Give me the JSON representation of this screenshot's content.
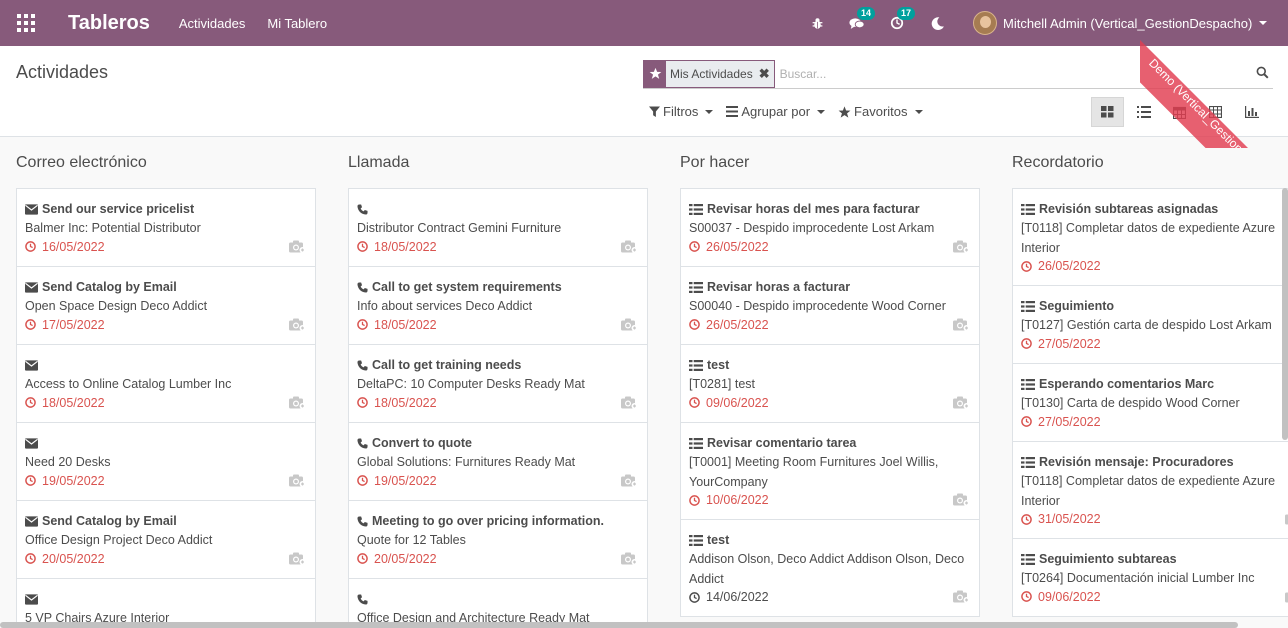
{
  "navbar": {
    "brand": "Tableros",
    "menu": [
      "Actividades",
      "Mi Tablero"
    ],
    "messages_count": "14",
    "activities_count": "17",
    "user": "Mitchell Admin (Vertical_GestionDespacho)"
  },
  "ribbon": {
    "text": "Demo (Vertical_GestionDespacho)"
  },
  "control_panel": {
    "breadcrumb": "Actividades",
    "facet": "Mis Actividades",
    "search_placeholder": "Buscar...",
    "filters_label": "Filtros",
    "groupby_label": "Agrupar por",
    "favorites_label": "Favoritos"
  },
  "colors": {
    "navbar": "#875a7b",
    "overdue": "#d9534f",
    "badge": "#00a09d"
  },
  "columns": [
    {
      "title": "Correo electrónico",
      "icon": "envelope-icon",
      "cards": [
        {
          "title": "Send our service pricelist",
          "body": "Balmer Inc: Potential Distributor",
          "date": "16/05/2022"
        },
        {
          "title": "Send Catalog by Email",
          "body": "Open Space Design Deco Addict",
          "date": "17/05/2022"
        },
        {
          "title": "",
          "body": "Access to Online Catalog Lumber Inc",
          "date": "18/05/2022"
        },
        {
          "title": "",
          "body": "Need 20 Desks",
          "date": "19/05/2022"
        },
        {
          "title": "Send Catalog by Email",
          "body": "Office Design Project Deco Addict",
          "date": "20/05/2022"
        },
        {
          "title": "",
          "body": "5 VP Chairs Azure Interior",
          "date": ""
        }
      ]
    },
    {
      "title": "Llamada",
      "icon": "phone-icon",
      "cards": [
        {
          "title": "",
          "body": "Distributor Contract Gemini Furniture",
          "date": "18/05/2022"
        },
        {
          "title": "Call to get system requirements",
          "body": "Info about services Deco Addict",
          "date": "18/05/2022"
        },
        {
          "title": "Call to get training needs",
          "body": "DeltaPC: 10 Computer Desks Ready Mat",
          "date": "18/05/2022"
        },
        {
          "title": "Convert to quote",
          "body": "Global Solutions: Furnitures Ready Mat",
          "date": "19/05/2022"
        },
        {
          "title": "Meeting to go over pricing information.",
          "body": "Quote for 12 Tables",
          "date": "20/05/2022"
        },
        {
          "title": "",
          "body": "Office Design and Architecture Ready Mat",
          "date": ""
        }
      ]
    },
    {
      "title": "Por hacer",
      "icon": "tasks-icon",
      "cards": [
        {
          "title": "Revisar horas del mes para facturar",
          "body": "S00037 - Despido improcedente Lost Arkam",
          "date": "26/05/2022"
        },
        {
          "title": "Revisar horas a facturar",
          "body": "S00040 - Despido improcedente Wood Corner",
          "date": "26/05/2022"
        },
        {
          "title": "test",
          "body": "[T0281] test",
          "date": "09/06/2022"
        },
        {
          "title": "Revisar comentario tarea",
          "body": "[T0001] Meeting Room Furnitures Joel Willis, YourCompany",
          "date": "10/06/2022",
          "tall": true
        },
        {
          "title": "test",
          "body": "Addison Olson, Deco Addict Addison Olson, Deco Addict",
          "date": "14/06/2022",
          "tall": true,
          "ok": true
        }
      ]
    },
    {
      "title": "Recordatorio",
      "icon": "tasks-icon",
      "cards": [
        {
          "title": "Revisión subtareas asignadas",
          "body": "[T0118] Completar datos de expediente Azure Interior",
          "date": "26/05/2022",
          "tall": true
        },
        {
          "title": "Seguimiento",
          "body": "[T0127] Gestión carta de despido Lost Arkam",
          "date": "27/05/2022"
        },
        {
          "title": "Esperando comentarios Marc",
          "body": "[T0130] Carta de despido Wood Corner",
          "date": "27/05/2022"
        },
        {
          "title": "Revisión mensaje: Procuradores",
          "body": "[T0118] Completar datos de expediente Azure Interior",
          "date": "31/05/2022",
          "tall": true
        },
        {
          "title": "Seguimiento subtareas",
          "body": "[T0264] Documentación inicial Lumber Inc",
          "date": "09/06/2022"
        }
      ]
    }
  ]
}
